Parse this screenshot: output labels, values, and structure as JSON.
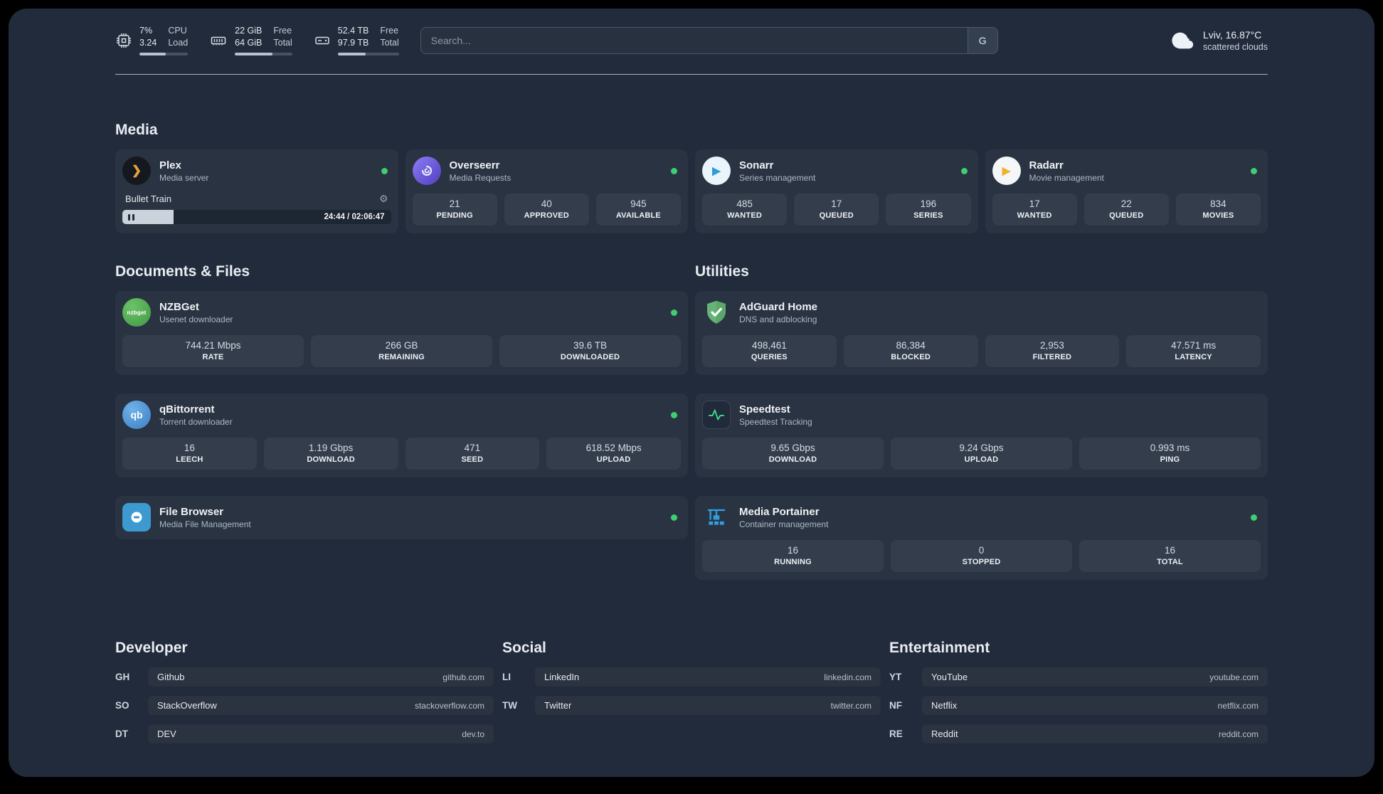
{
  "colors": {
    "status-online": "#3fce71",
    "accent-plex": "#e8a33d",
    "accent-sonarr": "#2f9cd8",
    "accent-radarr": "#f0b02f",
    "accent-overseerr": "#6d5bd0",
    "accent-nzbget": "#4caf50",
    "accent-qbittorrent": "#4790d0",
    "accent-adguard": "#67b279",
    "accent-speedtest": "#3fd98a",
    "accent-filebrowser": "#3d9ad1",
    "accent-portainer": "#2f9fe0"
  },
  "icons": {
    "gear": "⚙",
    "plex_glyph": "❯",
    "sonarr_glyph": "▶",
    "radarr_glyph": "▶",
    "nzbget_text": "nzbget",
    "qbittorrent_text": "qb"
  },
  "topbar": {
    "cpu": {
      "percent": "7%",
      "value": "3.24",
      "label_top": "CPU",
      "label_bottom": "Load",
      "bar_percent": 55
    },
    "ram": {
      "free": "22 GiB",
      "total": "64 GiB",
      "label_top": "Free",
      "label_bottom": "Total",
      "bar_percent": 65
    },
    "disk": {
      "free": "52.4 TB",
      "total": "97.9 TB",
      "label_top": "Free",
      "label_bottom": "Total",
      "bar_percent": 46
    },
    "search": {
      "placeholder": "Search...",
      "button_label": "G"
    },
    "weather": {
      "location": "Lviv, 16.87°C",
      "condition": "scattered clouds"
    }
  },
  "sections": {
    "media": "Media",
    "documents": "Documents & Files",
    "utilities": "Utilities",
    "developer": "Developer",
    "social": "Social",
    "entertainment": "Entertainment"
  },
  "apps": {
    "plex": {
      "name": "Plex",
      "subtitle": "Media server",
      "now_playing": {
        "title": "Bullet Train",
        "time": "24:44 / 02:06:47",
        "progress_percent": 19
      }
    },
    "overseerr": {
      "name": "Overseerr",
      "subtitle": "Media Requests",
      "stats": [
        {
          "value": "21",
          "label": "PENDING"
        },
        {
          "value": "40",
          "label": "APPROVED"
        },
        {
          "value": "945",
          "label": "AVAILABLE"
        }
      ]
    },
    "sonarr": {
      "name": "Sonarr",
      "subtitle": "Series management",
      "stats": [
        {
          "value": "485",
          "label": "WANTED"
        },
        {
          "value": "17",
          "label": "QUEUED"
        },
        {
          "value": "196",
          "label": "SERIES"
        }
      ]
    },
    "radarr": {
      "name": "Radarr",
      "subtitle": "Movie management",
      "stats": [
        {
          "value": "17",
          "label": "WANTED"
        },
        {
          "value": "22",
          "label": "QUEUED"
        },
        {
          "value": "834",
          "label": "MOVIES"
        }
      ]
    },
    "nzbget": {
      "name": "NZBGet",
      "subtitle": "Usenet downloader",
      "stats": [
        {
          "value": "744.21 Mbps",
          "label": "RATE"
        },
        {
          "value": "266 GB",
          "label": "REMAINING"
        },
        {
          "value": "39.6 TB",
          "label": "DOWNLOADED"
        }
      ]
    },
    "qbittorrent": {
      "name": "qBittorrent",
      "subtitle": "Torrent downloader",
      "stats": [
        {
          "value": "16",
          "label": "LEECH"
        },
        {
          "value": "1.19 Gbps",
          "label": "DOWNLOAD"
        },
        {
          "value": "471",
          "label": "SEED"
        },
        {
          "value": "618.52 Mbps",
          "label": "UPLOAD"
        }
      ]
    },
    "filebrowser": {
      "name": "File Browser",
      "subtitle": "Media File Management"
    },
    "adguard": {
      "name": "AdGuard Home",
      "subtitle": "DNS and adblocking",
      "stats": [
        {
          "value": "498,461",
          "label": "QUERIES"
        },
        {
          "value": "86,384",
          "label": "BLOCKED"
        },
        {
          "value": "2,953",
          "label": "FILTERED"
        },
        {
          "value": "47.571 ms",
          "label": "LATENCY"
        }
      ]
    },
    "speedtest": {
      "name": "Speedtest",
      "subtitle": "Speedtest Tracking",
      "stats": [
        {
          "value": "9.65 Gbps",
          "label": "DOWNLOAD"
        },
        {
          "value": "9.24 Gbps",
          "label": "UPLOAD"
        },
        {
          "value": "0.993 ms",
          "label": "PING"
        }
      ]
    },
    "portainer": {
      "name": "Media Portainer",
      "subtitle": "Container management",
      "stats": [
        {
          "value": "16",
          "label": "RUNNING"
        },
        {
          "value": "0",
          "label": "STOPPED"
        },
        {
          "value": "16",
          "label": "TOTAL"
        }
      ]
    }
  },
  "bookmarks": {
    "developer": [
      {
        "abbr": "GH",
        "name": "Github",
        "url": "github.com"
      },
      {
        "abbr": "SO",
        "name": "StackOverflow",
        "url": "stackoverflow.com"
      },
      {
        "abbr": "DT",
        "name": "DEV",
        "url": "dev.to"
      }
    ],
    "social": [
      {
        "abbr": "LI",
        "name": "LinkedIn",
        "url": "linkedin.com"
      },
      {
        "abbr": "TW",
        "name": "Twitter",
        "url": "twitter.com"
      }
    ],
    "entertainment": [
      {
        "abbr": "YT",
        "name": "YouTube",
        "url": "youtube.com"
      },
      {
        "abbr": "NF",
        "name": "Netflix",
        "url": "netflix.com"
      },
      {
        "abbr": "RE",
        "name": "Reddit",
        "url": "reddit.com"
      }
    ]
  }
}
